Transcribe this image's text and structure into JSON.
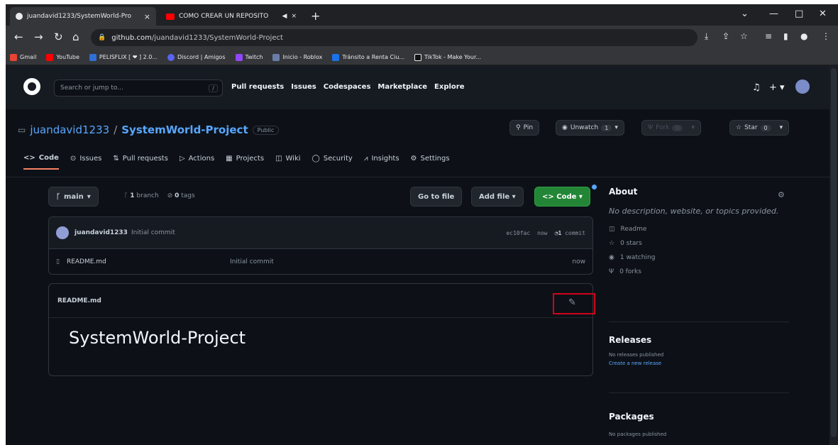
{
  "browser": {
    "tabs": [
      {
        "title": "juandavid1233/SystemWorld-Pro",
        "close": "×",
        "favicon": "github-icon"
      },
      {
        "title": "COMO CREAR UN REPOSITO",
        "close": "×",
        "extra": "◀",
        "favicon": "youtube-icon"
      }
    ],
    "new_tab": "+",
    "window_controls": [
      "⌄",
      "—",
      "□",
      "✕"
    ],
    "url_host": "github.com",
    "url_path": "/juandavid1233/SystemWorld-Project",
    "bookmarks": [
      {
        "label": "Gmail",
        "color": "#ea4335"
      },
      {
        "label": "YouTube",
        "color": "#ff0000"
      },
      {
        "label": "PELISFLIX [ ❤ ] 2.0...",
        "color": "#2f6fd6"
      },
      {
        "label": "Discord | Amigos",
        "color": "#5865f2"
      },
      {
        "label": "Twitch",
        "color": "#9146ff"
      },
      {
        "label": "Inicio - Roblox",
        "color": "#6a7da8"
      },
      {
        "label": "Tránsito a Renta Ciu...",
        "color": "#1a73e8"
      },
      {
        "label": "TikTok - Make Your...",
        "color": "#111111"
      }
    ]
  },
  "github": {
    "search_placeholder": "Search or jump to...",
    "search_key": "/",
    "nav": [
      "Pull requests",
      "Issues",
      "Codespaces",
      "Marketplace",
      "Explore"
    ],
    "bell": "🔔",
    "plus": "+ ▾"
  },
  "repo": {
    "owner": "juandavid1233",
    "slash": "/",
    "name": "SystemWorld-Project",
    "visibility": "Public",
    "pin": "Pin",
    "unwatch": "Unwatch",
    "watch_count": "1",
    "fork": "Fork",
    "fork_count": "0",
    "star": "Star",
    "star_count": "0",
    "tabs": [
      "Code",
      "Issues",
      "Pull requests",
      "Actions",
      "Projects",
      "Wiki",
      "Security",
      "Insights",
      "Settings"
    ]
  },
  "code": {
    "branch": "main",
    "branch_count": "1",
    "branch_word": "branch",
    "tag_count": "0",
    "tag_word": "tags",
    "go_to_file": "Go to file",
    "add_file": "Add file ▾",
    "code_btn": "<> Code ▾",
    "commit_author": "juandavid1233",
    "commit_message": "Initial commit",
    "commit_hash": "ec10fac",
    "commit_time": "now",
    "commit_count": "1",
    "commit_word": "commit",
    "files": [
      {
        "name": "README.md",
        "message": "Initial commit",
        "time": "now"
      }
    ],
    "readme_title": "README.md",
    "readme_heading": "SystemWorld-Project"
  },
  "about": {
    "title": "About",
    "description": "No description, website, or topics provided.",
    "readme": "Readme",
    "stars": "0 stars",
    "watching": "1 watching",
    "forks": "0 forks",
    "releases_title": "Releases",
    "releases_none": "No releases published",
    "releases_link": "Create a new release",
    "packages_title": "Packages",
    "packages_none": "No packages published"
  }
}
